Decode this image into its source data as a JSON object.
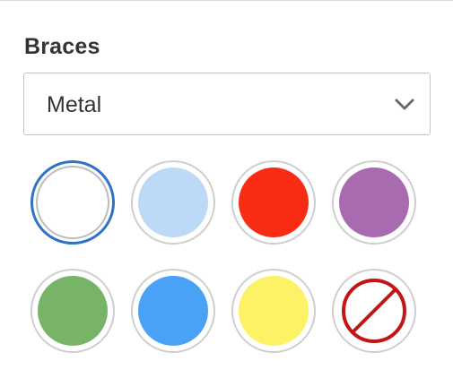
{
  "section": {
    "title": "Braces"
  },
  "material_select": {
    "selected": "Metal"
  },
  "colors": {
    "swatches": [
      {
        "name": "white",
        "hex": "#ffffff",
        "selected": true
      },
      {
        "name": "light-blue",
        "hex": "#bcd9f6",
        "selected": false
      },
      {
        "name": "red",
        "hex": "#f82c14",
        "selected": false
      },
      {
        "name": "purple",
        "hex": "#a96bb0",
        "selected": false
      },
      {
        "name": "green",
        "hex": "#78b468",
        "selected": false
      },
      {
        "name": "blue",
        "hex": "#4aa2f6",
        "selected": false
      },
      {
        "name": "yellow",
        "hex": "#fdf266",
        "selected": false
      },
      {
        "name": "none",
        "hex": "#ffffff",
        "icon": "no-color-icon",
        "selected": false
      }
    ],
    "selected_border": "#2f73c8",
    "none_stroke": "#c21515"
  }
}
